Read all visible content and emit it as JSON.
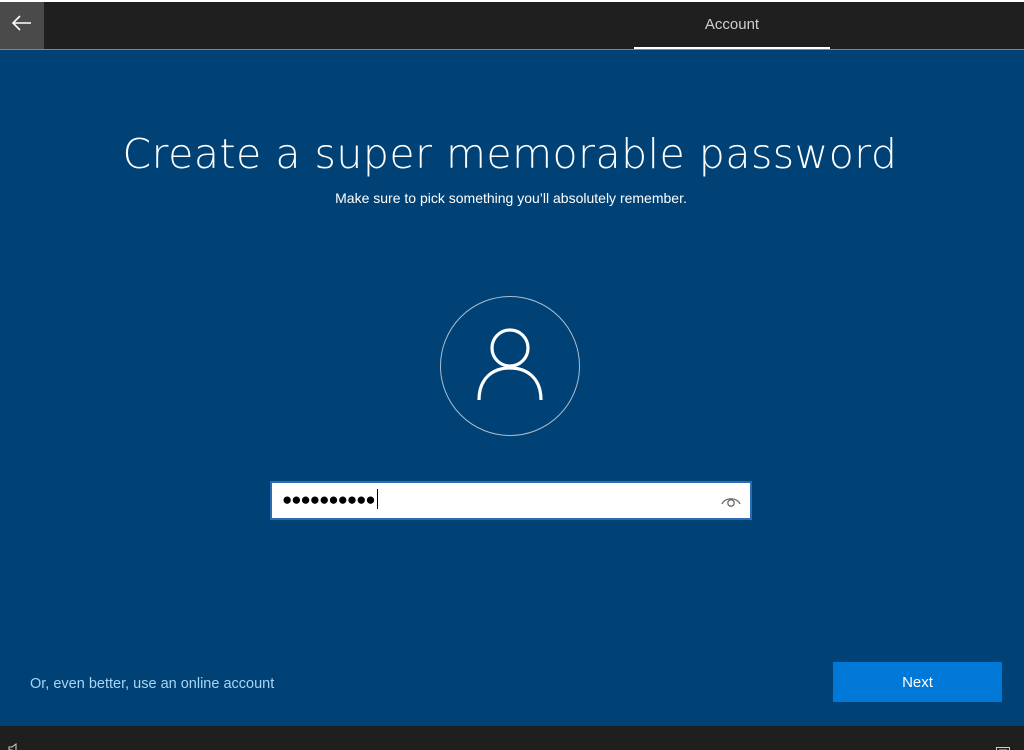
{
  "header": {
    "back_icon": "arrow-left-icon",
    "tab_label": "Account"
  },
  "main": {
    "title": "Create a super memorable password",
    "subtitle": "Make sure to pick something you’ll absolutely remember.",
    "avatar_icon": "user-icon",
    "password_field": {
      "value_masked": "●●●●●●●●●●",
      "reveal_icon": "eye-icon"
    },
    "online_account_link": "Or, even better, use an online account",
    "next_button": "Next"
  },
  "taskbar": {
    "left_icon": "speaker-icon",
    "right_icon": "keyboard-icon"
  },
  "colors": {
    "background": "#004275",
    "bars": "#1f1f1f",
    "accent": "#0078d7",
    "link": "#a8d4f5"
  }
}
